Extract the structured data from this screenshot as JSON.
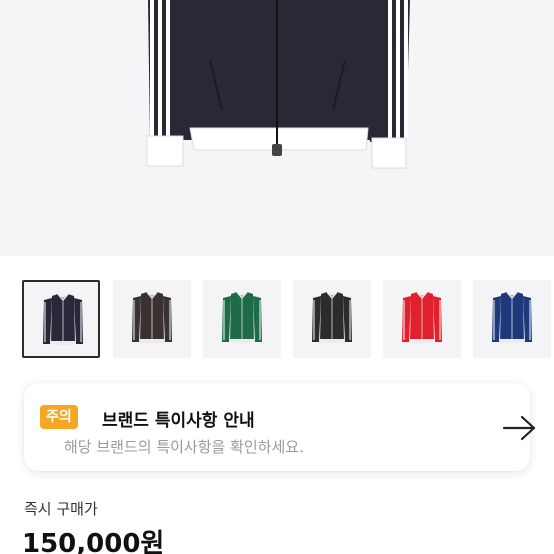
{
  "colors": {
    "hero_bg": "#f5f5f7",
    "badge_bg": "#f5a623",
    "thumb_selected_border": "#2b2b2b"
  },
  "hero": {
    "image": "black-track-jacket-with-white-stripes"
  },
  "thumbnails": [
    {
      "label": "navy-black-track-jacket",
      "color": "#2a2838",
      "selected": true
    },
    {
      "label": "dark-brown-track-jacket",
      "color": "#3a3230",
      "selected": false
    },
    {
      "label": "green-track-jacket",
      "color": "#1f6b45",
      "selected": false
    },
    {
      "label": "black-track-jacket",
      "color": "#2c2c2c",
      "selected": false
    },
    {
      "label": "red-track-jacket",
      "color": "#e0202c",
      "selected": false
    },
    {
      "label": "navy-blue-track-jacket",
      "color": "#1f3a7a",
      "selected": false
    }
  ],
  "notice": {
    "badge": "주의",
    "title": "브랜드 특이사항 안내",
    "description": "해당 브랜드의 특이사항을 확인하세요.",
    "arrow_icon": "arrow-right-icon"
  },
  "price": {
    "label": "즉시 구매가",
    "value": "150,000원"
  }
}
